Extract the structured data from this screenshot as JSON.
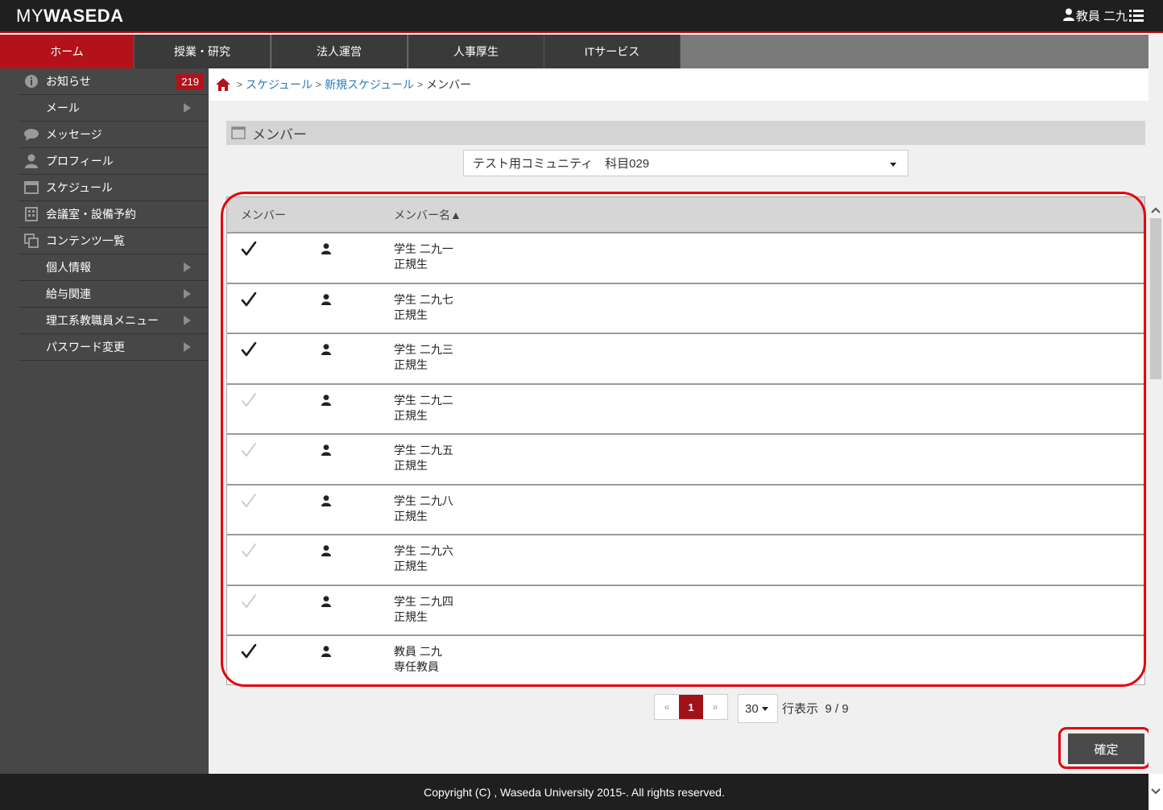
{
  "header": {
    "logo_my": "MY",
    "logo_waseda": "WASEDA",
    "user_name": "教員 二九"
  },
  "nav": {
    "tabs": [
      {
        "label": "ホーム"
      },
      {
        "label": "授業・研究"
      },
      {
        "label": "法人運営"
      },
      {
        "label": "人事厚生"
      },
      {
        "label": "ITサービス"
      }
    ]
  },
  "sidebar": {
    "items": [
      {
        "label": "お知らせ",
        "icon": "info-icon",
        "badge": "219"
      },
      {
        "label": "メール",
        "icon": "",
        "arrow": true
      },
      {
        "label": "メッセージ",
        "icon": "speech-bubble-icon"
      },
      {
        "label": "プロフィール",
        "icon": "user-icon"
      },
      {
        "label": "スケジュール",
        "icon": "calendar-icon"
      },
      {
        "label": "会議室・設備予約",
        "icon": "building-icon"
      },
      {
        "label": "コンテンツ一覧",
        "icon": "content-list-icon"
      },
      {
        "label": "個人情報",
        "icon": "",
        "arrow": true
      },
      {
        "label": "給与関連",
        "icon": "",
        "arrow": true
      },
      {
        "label": "理工系教職員メニュー",
        "icon": "",
        "arrow": true
      },
      {
        "label": "パスワード変更",
        "icon": "",
        "arrow": true
      }
    ]
  },
  "breadcrumb": {
    "items": [
      "スケジュール",
      "新規スケジュール",
      "メンバー"
    ],
    "separator": ">"
  },
  "section": {
    "title": "メンバー"
  },
  "community_select": {
    "value": "テスト用コミュニティ　科目029"
  },
  "table": {
    "col_member": "メンバー",
    "col_member_name": "メンバー名▲",
    "rows": [
      {
        "name": "学生 二九一",
        "type": "正規生",
        "checked": true
      },
      {
        "name": "学生 二九七",
        "type": "正規生",
        "checked": true
      },
      {
        "name": "学生 二九三",
        "type": "正規生",
        "checked": true
      },
      {
        "name": "学生 二九二",
        "type": "正規生",
        "checked": false
      },
      {
        "name": "学生 二九五",
        "type": "正規生",
        "checked": false
      },
      {
        "name": "学生 二九八",
        "type": "正規生",
        "checked": false
      },
      {
        "name": "学生 二九六",
        "type": "正規生",
        "checked": false
      },
      {
        "name": "学生 二九四",
        "type": "正規生",
        "checked": false
      },
      {
        "name": "教員 二九",
        "type": "専任教員",
        "checked": true
      }
    ]
  },
  "pagination": {
    "prev": "«",
    "current": "1",
    "next": "»",
    "per_page": "30",
    "rows_label": "行表示",
    "count": "9 / 9"
  },
  "confirm_label": "確定",
  "footer": {
    "copyright": "Copyright (C) , Waseda University 2015-. All rights reserved."
  },
  "colors": {
    "accent_red": "#b3121a",
    "highlight_red": "#e3000f",
    "link_blue": "#2a7ab8"
  }
}
